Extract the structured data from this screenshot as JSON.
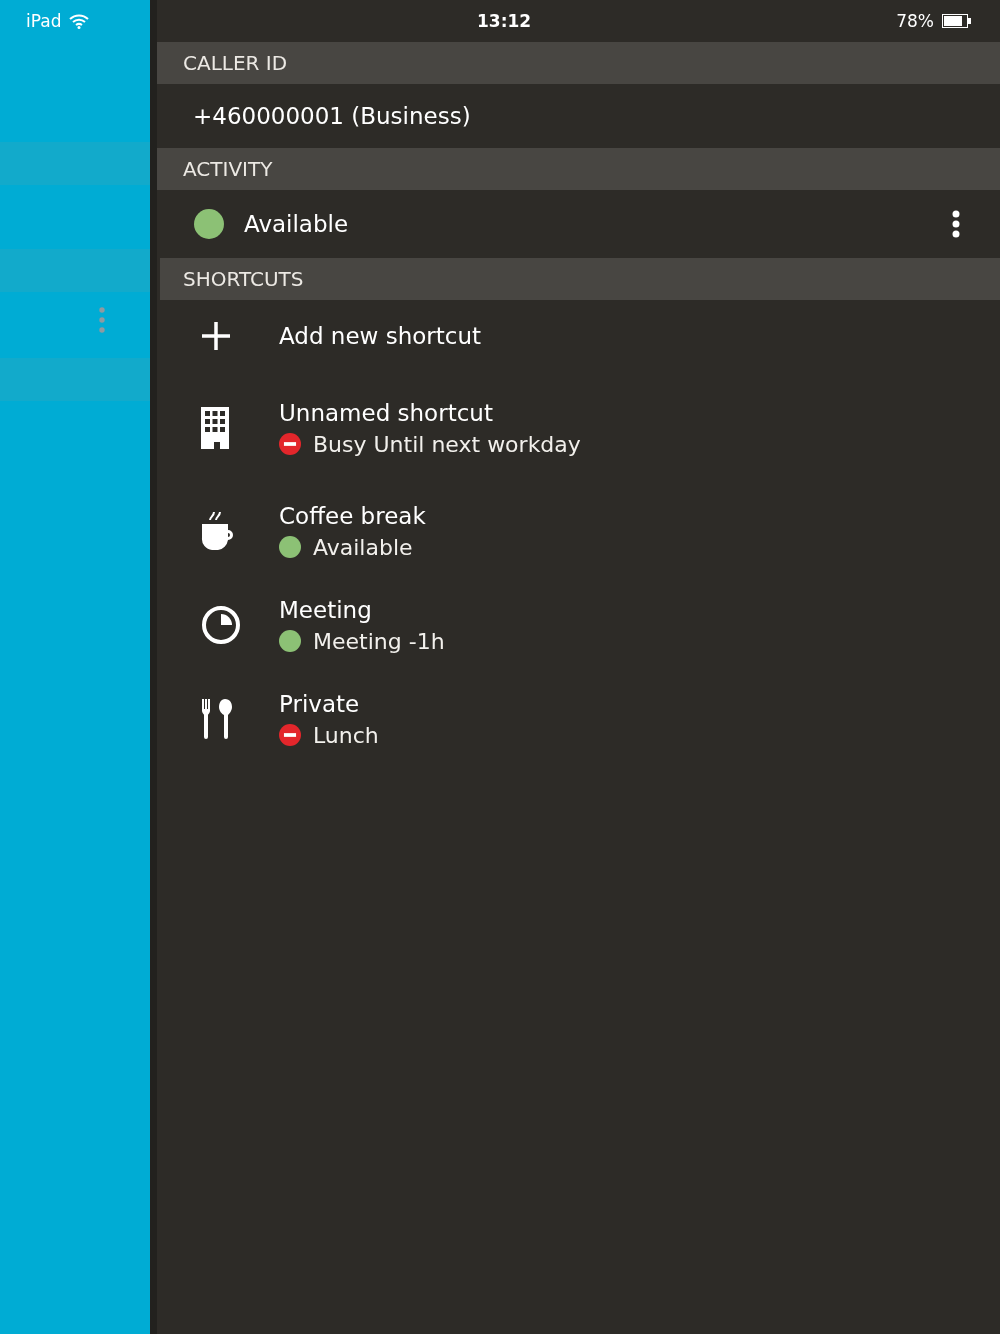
{
  "status_bar": {
    "device": "iPad",
    "time": "13:12",
    "battery": "78%"
  },
  "caller_id": {
    "header": "CALLER ID",
    "value": "+460000001 (Business)"
  },
  "activity": {
    "header": "ACTIVITY",
    "busy": false,
    "label": "Available"
  },
  "shortcuts": {
    "header": "SHORTCUTS",
    "add_label": "Add new shortcut",
    "items": [
      {
        "kind": "building",
        "title": "Unnamed shortcut",
        "busy": true,
        "detail": "Busy Until next workday"
      },
      {
        "kind": "coffee",
        "title": "Coffee break",
        "busy": false,
        "detail": "Available"
      },
      {
        "kind": "clock",
        "title": "Meeting",
        "busy": false,
        "detail": "Meeting -1h"
      },
      {
        "kind": "cutlery",
        "title": "Private",
        "busy": true,
        "detail": "Lunch"
      }
    ]
  }
}
